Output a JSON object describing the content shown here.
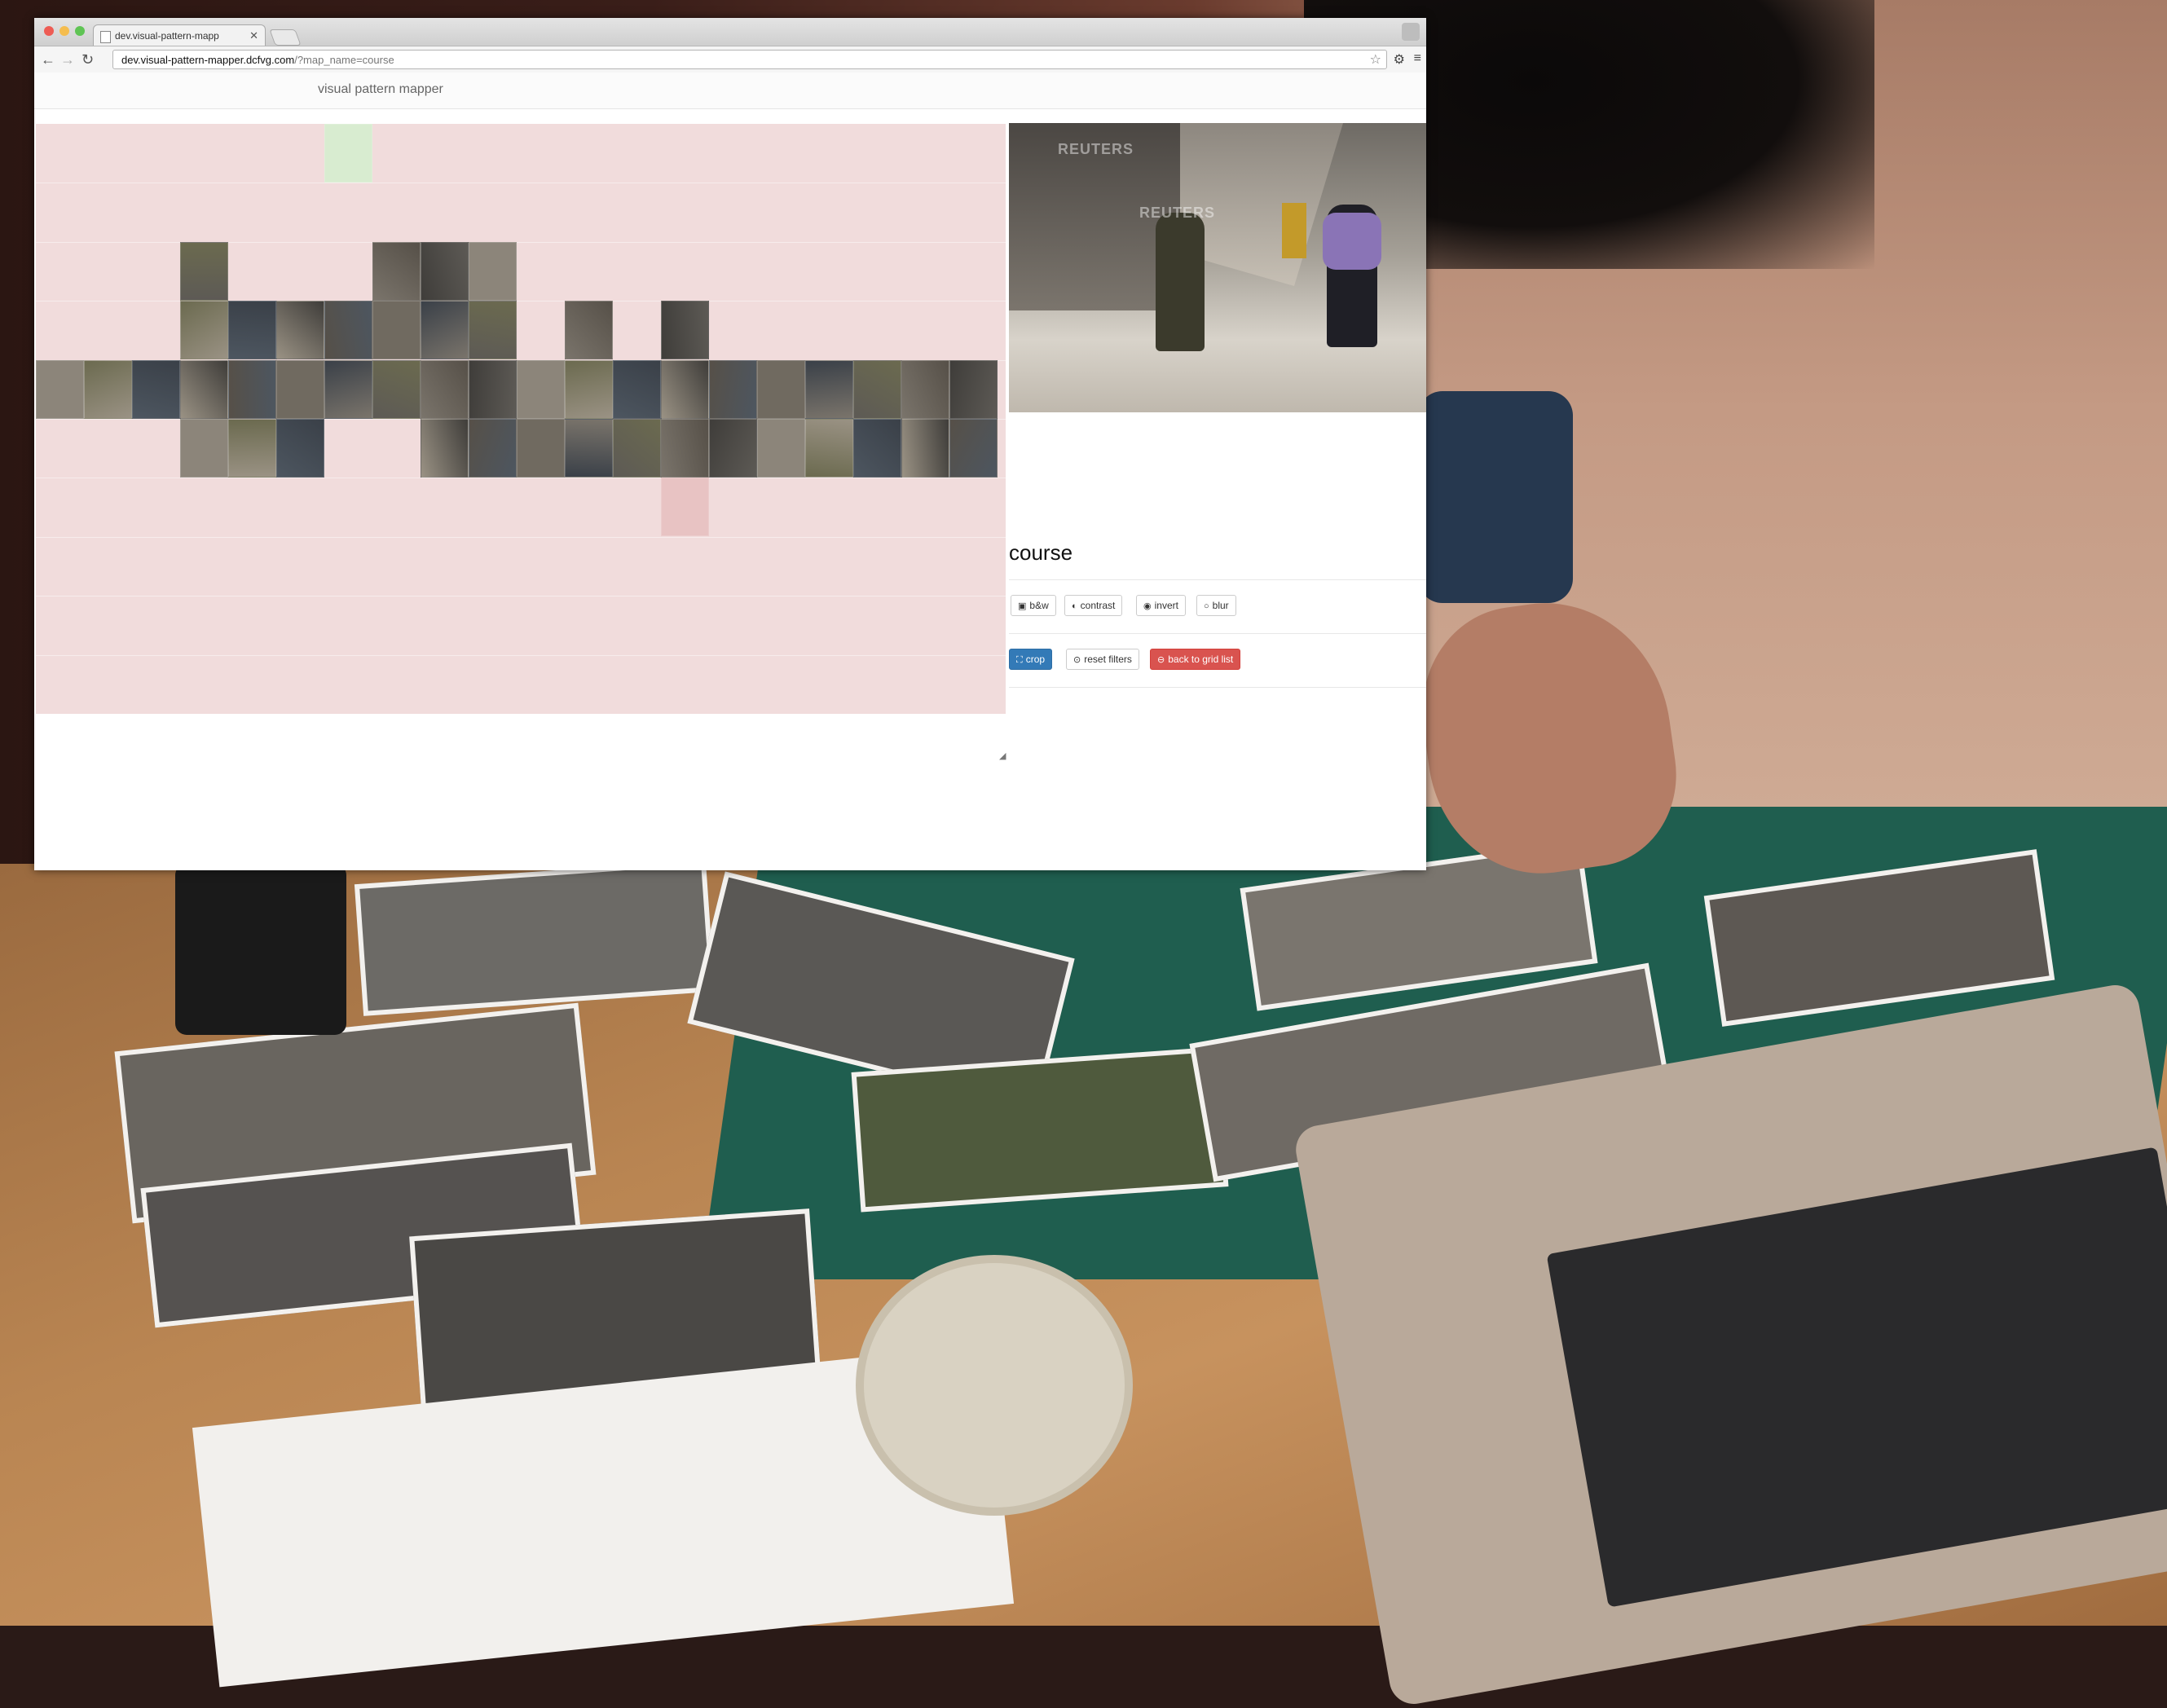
{
  "browser": {
    "tab_title": "dev.visual-pattern-mapp",
    "url_host": "dev.visual-pattern-mapper.dcfvg.com",
    "url_path": "/?map_name=course"
  },
  "page": {
    "brand": "visual pattern mapper",
    "map_title": "course",
    "filters": [
      {
        "label": "b&w",
        "icon": "image-icon"
      },
      {
        "label": "contrast",
        "icon": "contrast-icon"
      },
      {
        "label": "invert",
        "icon": "eye-slash-icon"
      },
      {
        "label": "blur",
        "icon": "circle-icon"
      }
    ],
    "actions": {
      "crop": "crop",
      "reset": "reset filters",
      "back": "back to grid list"
    },
    "preview_watermark": "REUTERS",
    "colors": {
      "grid_background": "#f1dcdc",
      "highlight_green": "#d8ecd0",
      "highlight_red": "#e8c3c3",
      "primary": "#337ab7",
      "danger": "#d9534f"
    }
  }
}
